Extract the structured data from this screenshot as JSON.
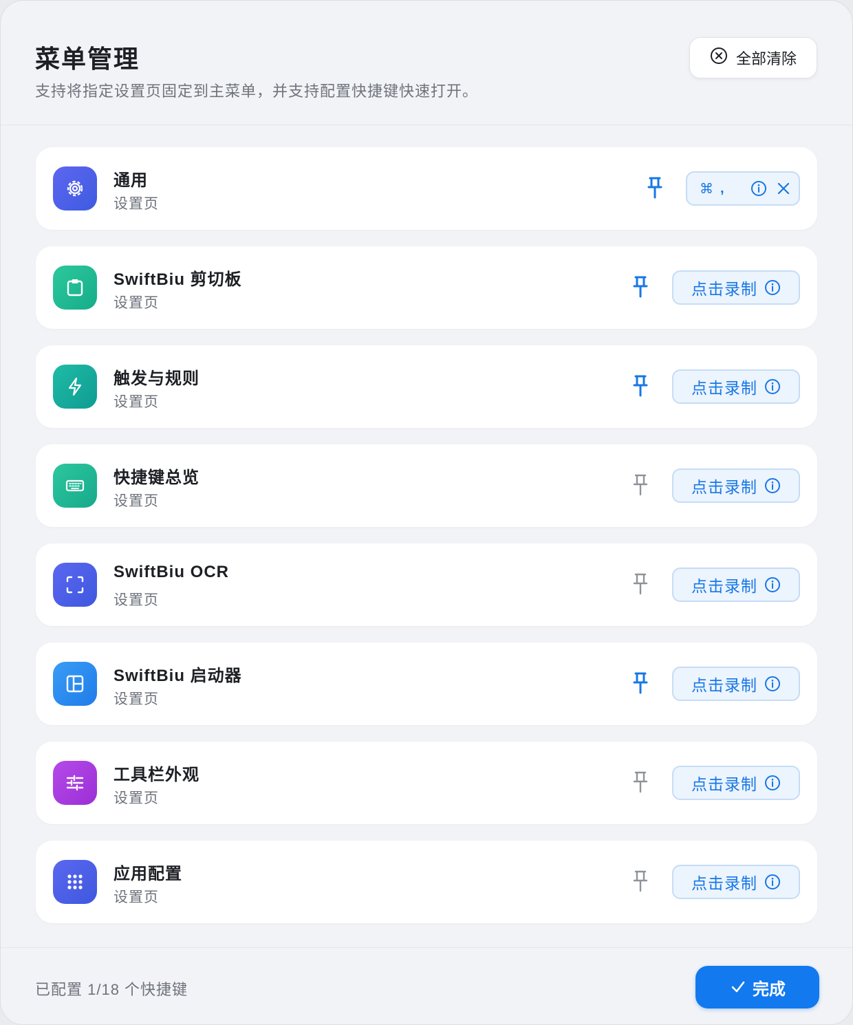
{
  "header": {
    "title": "菜单管理",
    "subtitle": "支持将指定设置页固定到主菜单，并支持配置快捷键快速打开。",
    "clear_all_label": "全部清除"
  },
  "items": [
    {
      "name": "通用",
      "sub": "设置页",
      "icon": "gear-icon",
      "pinned": true,
      "shortcut": [
        "⌘",
        ","
      ]
    },
    {
      "name": "SwiftBiu 剪切板",
      "sub": "设置页",
      "icon": "clipboard-icon",
      "pinned": true,
      "record_label": "点击录制"
    },
    {
      "name": "触发与规则",
      "sub": "设置页",
      "icon": "bolt-icon",
      "pinned": true,
      "record_label": "点击录制"
    },
    {
      "name": "快捷键总览",
      "sub": "设置页",
      "icon": "keyboard-icon",
      "pinned": false,
      "record_label": "点击录制"
    },
    {
      "name": "SwiftBiu OCR",
      "sub": "设置页",
      "icon": "scan-icon",
      "pinned": false,
      "record_label": "点击录制"
    },
    {
      "name": "SwiftBiu 启动器",
      "sub": "设置页",
      "icon": "launcher-icon",
      "pinned": true,
      "record_label": "点击录制"
    },
    {
      "name": "工具栏外观",
      "sub": "设置页",
      "icon": "sliders-icon",
      "pinned": false,
      "record_label": "点击录制"
    },
    {
      "name": "应用配置",
      "sub": "设置页",
      "icon": "grid-dots-icon",
      "pinned": false,
      "record_label": "点击录制"
    }
  ],
  "footer": {
    "status": "已配置 1/18 个快捷键",
    "done_label": "完成"
  },
  "colors": {
    "accent": "#1279EE",
    "pin_active": "#1777E5",
    "pin_inactive": "#8E939B",
    "record_bg": "#ECF4FD"
  }
}
